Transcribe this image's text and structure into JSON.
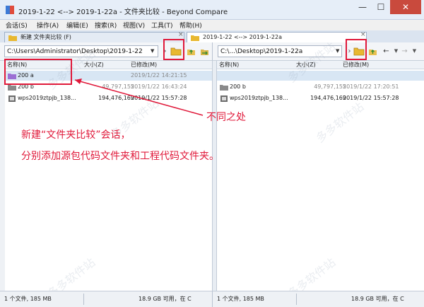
{
  "window": {
    "title": "2019-1-22 <--> 2019-1-22a - 文件夹比较 - Beyond Compare",
    "minimize_label": "—",
    "maximize_label": "☐",
    "close_label": "✕"
  },
  "menu": [
    "会话(S)",
    "操作(A)",
    "编辑(E)",
    "搜索(R)",
    "视图(V)",
    "工具(T)",
    "帮助(H)"
  ],
  "tabs": [
    {
      "label": "新建 文件夹比较 (F)",
      "close": "×"
    },
    {
      "label": "2019-1-22 <--> 2019-1-22a",
      "close": "×"
    }
  ],
  "left_path": "C:\\Users\\Administrator\\Desktop\\2019-1-22",
  "right_path": "C:\\...\\Desktop\\2019-1-22a",
  "toolbar_glyphs": {
    "left_arrow": "›",
    "back": "←",
    "forward": "→"
  },
  "columns": {
    "name": "名称(N)",
    "size": "大小(Z)",
    "modified": "已修改(M)"
  },
  "left_rows": [
    {
      "name": "200 a",
      "size": "",
      "date": "2019/1/22 14:21:15",
      "type": "folder-purple",
      "selected": true,
      "muted": false
    },
    {
      "name": "200 b",
      "size": "49,797,155",
      "date": "2019/1/22 16:43:24",
      "type": "folder-gray",
      "selected": false,
      "muted": true
    },
    {
      "name": "wps2019ztpjb_138...",
      "size": "194,476,169",
      "date": "2019/1/22 15:57:28",
      "type": "exe",
      "selected": false,
      "muted": false
    }
  ],
  "right_rows": [
    {
      "name": "",
      "size": "",
      "date": "",
      "type": "none",
      "selected": true,
      "muted": false
    },
    {
      "name": "200 b",
      "size": "49,797,155",
      "date": "2019/1/22 17:20:51",
      "type": "folder-gray",
      "selected": false,
      "muted": false
    },
    {
      "name": "wps2019ztpjb_138...",
      "size": "194,476,169",
      "date": "2019/1/22 15:57:28",
      "type": "exe",
      "selected": false,
      "muted": false
    }
  ],
  "status": {
    "left_count": "1 个文件, 185 MB",
    "left_free": "18.9 GB 可用，在 C",
    "right_count": "1 个文件, 185 MB",
    "right_free": "18.9 GB 可用，在 C"
  },
  "annotations": {
    "diff_label": "不同之处",
    "line1": "新建“文件夹比较”会话，",
    "line2": "分别添加源包代码文件夹和工程代码文件夹。"
  },
  "watermark": "多多软件站",
  "colors": {
    "annotation_red": "#e0193a",
    "selected_row": "#d8e6f4",
    "folder_yellow": "#e8b830",
    "folder_purple": "#9b6fd4"
  }
}
